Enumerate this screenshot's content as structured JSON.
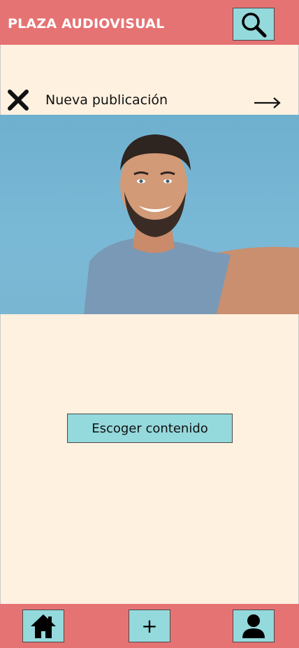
{
  "header": {
    "title": "PLAZA AUDIOVISUAL",
    "search_icon": "search-icon"
  },
  "subheader": {
    "title": "Nueva publicación",
    "close_icon": "close-icon",
    "next_icon": "arrow-right-icon"
  },
  "main": {
    "choose_button_label": "Escoger contenido"
  },
  "footer": {
    "home_icon": "home-icon",
    "add_label": "+",
    "profile_icon": "user-icon"
  },
  "colors": {
    "header_bg": "#e57373",
    "page_bg": "#fef1e0",
    "button_bg": "#94d9dc"
  }
}
